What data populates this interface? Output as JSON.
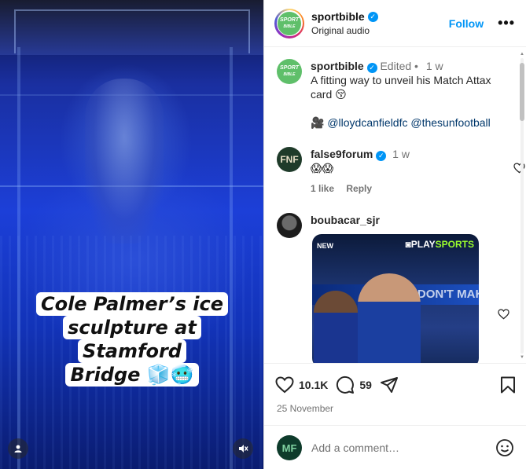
{
  "video": {
    "caption_line1": "Cole Palmer’s ice",
    "caption_line2": "sculpture at Stamford",
    "caption_line3": "Bridge",
    "caption_emoji": "🧊🥶",
    "user_icon": "person-icon",
    "mute_icon": "speaker-muted-icon"
  },
  "header": {
    "logo_text_top": "SPORT",
    "logo_text_bottom": "BIBLE",
    "username": "sportbible",
    "subtitle": "Original audio",
    "follow_label": "Follow",
    "more_label": "•••"
  },
  "post": {
    "username": "sportbible",
    "edited": "Edited",
    "dot": "•",
    "age": "1 w",
    "text_line1": "A fitting way to unveil his Match Attax",
    "text_line2": "card",
    "text_emoji": "😚",
    "camera_emoji": "🎥",
    "mention1": "@lloydcanfieldfc",
    "mention2": "@thesunfootball"
  },
  "comments": [
    {
      "avatar_text": "FNF",
      "username": "false9forum",
      "age": "1 w",
      "text": "😱😱",
      "likes": "1 like",
      "reply": "Reply"
    },
    {
      "username": "boubacar_sjr",
      "gif_tag": "NEW",
      "gif_brand_prefix": "◙",
      "gif_brand_play": "PLAY",
      "gif_brand_sports": "SPORTS",
      "gif_banner": "THEY DON'T MAK"
    }
  ],
  "footer": {
    "likes": "10.1K",
    "comments": "59",
    "date": "25 November",
    "commenter_avatar": "MF",
    "comment_placeholder": "Add a comment…"
  },
  "colors": {
    "accent": "#0095f6",
    "mention": "#00376b",
    "muted": "#737373",
    "brand_green": "#5fbf6a"
  }
}
